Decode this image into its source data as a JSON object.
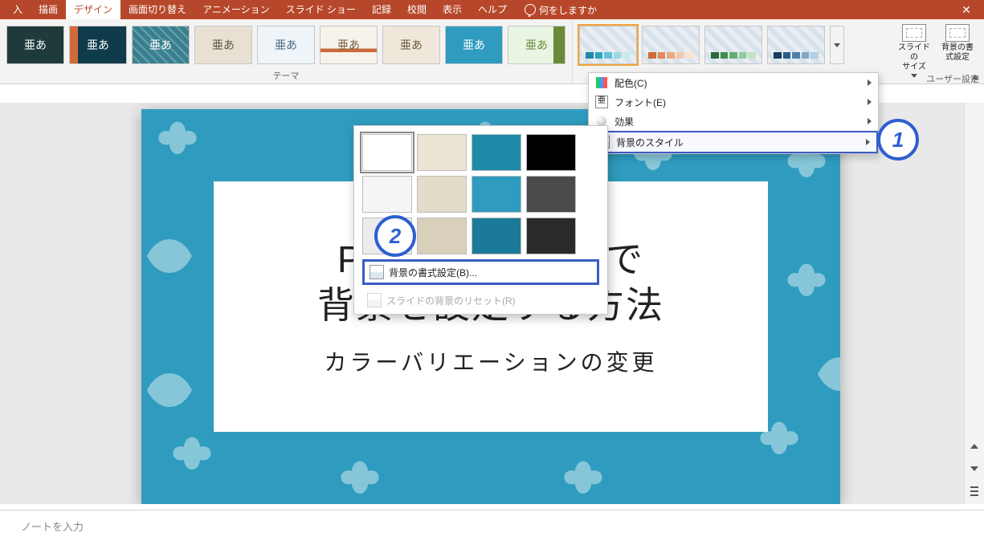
{
  "titlebar": {
    "close_glyph": "✕"
  },
  "tabs": {
    "items": [
      "入",
      "描画",
      "デザイン",
      "画面切り替え",
      "アニメーション",
      "スライド ショー",
      "記録",
      "校閲",
      "表示",
      "ヘルプ"
    ],
    "active_index": 2,
    "tell_me": "何をしますか"
  },
  "ribbon": {
    "themes_label": "テーマ",
    "theme_text": "亜あ",
    "theme_styles": [
      {
        "bg": "#1f3a3a",
        "fg": "#ffffff"
      },
      {
        "bg": "#0f3b4b",
        "fg": "#ffffff",
        "accent": "#d06a3a"
      },
      {
        "bg": "#38808f",
        "fg": "#ffffff",
        "pattern": true
      },
      {
        "bg": "#e8e1d3",
        "fg": "#5a5140"
      },
      {
        "bg": "#eef4f8",
        "fg": "#4a6b82"
      },
      {
        "bg": "#f7f3ea",
        "fg": "#7a5a3a",
        "stripe": true
      },
      {
        "bg": "#efe7da",
        "fg": "#6b5b3d"
      },
      {
        "bg": "#2f9cbf",
        "fg": "#ffffff"
      },
      {
        "bg": "#e8f5e2",
        "fg": "#6a8a3a",
        "side": true
      }
    ],
    "variant_bars": [
      [
        "#1f8aa8",
        "#2aa6c2",
        "#60c2d6",
        "#9ad7e3",
        "#c7e9ef"
      ],
      [
        "#d06a3a",
        "#e08a5a",
        "#eba97f",
        "#f3c7a8",
        "#f9e2d0"
      ],
      [
        "#2a6b3a",
        "#3f8d4f",
        "#62b06f",
        "#8fcc96",
        "#c1e4c3"
      ],
      [
        "#1d3a5f",
        "#2f5a88",
        "#4f80ad",
        "#7fa8c9",
        "#b4cfe1"
      ]
    ],
    "user_group": {
      "label": "ユーザー設定",
      "slide_size": "スライドの\nサイズ",
      "bg_format": "背景の書\n式設定"
    }
  },
  "dropdown": {
    "colors": "配色(C)",
    "fonts": "フォント(E)",
    "effects": "効果",
    "bg_styles": "背景のスタイル",
    "font_glyph": "亜"
  },
  "popout": {
    "swatches": [
      "#ffffff",
      "#ebe4d3",
      "#1f8aa8",
      "#000000",
      "#f5f5f5",
      "#e3dcc9",
      "#2f9cbf",
      "#4a4a4a",
      "#ececec",
      "#d9d0bb",
      "#1b7a98",
      "#2a2a2a"
    ],
    "selected_index": 0,
    "format_bg": "背景の書式設定(B)...",
    "reset_bg": "スライドの背景のリセット(R)"
  },
  "slide": {
    "title": "POWERPOINTで\n背景を設定する方法",
    "subtitle": "カラーバリエーションの変更"
  },
  "notes": {
    "placeholder": "ノートを入力"
  },
  "callouts": {
    "c1": "1",
    "c2": "2"
  }
}
